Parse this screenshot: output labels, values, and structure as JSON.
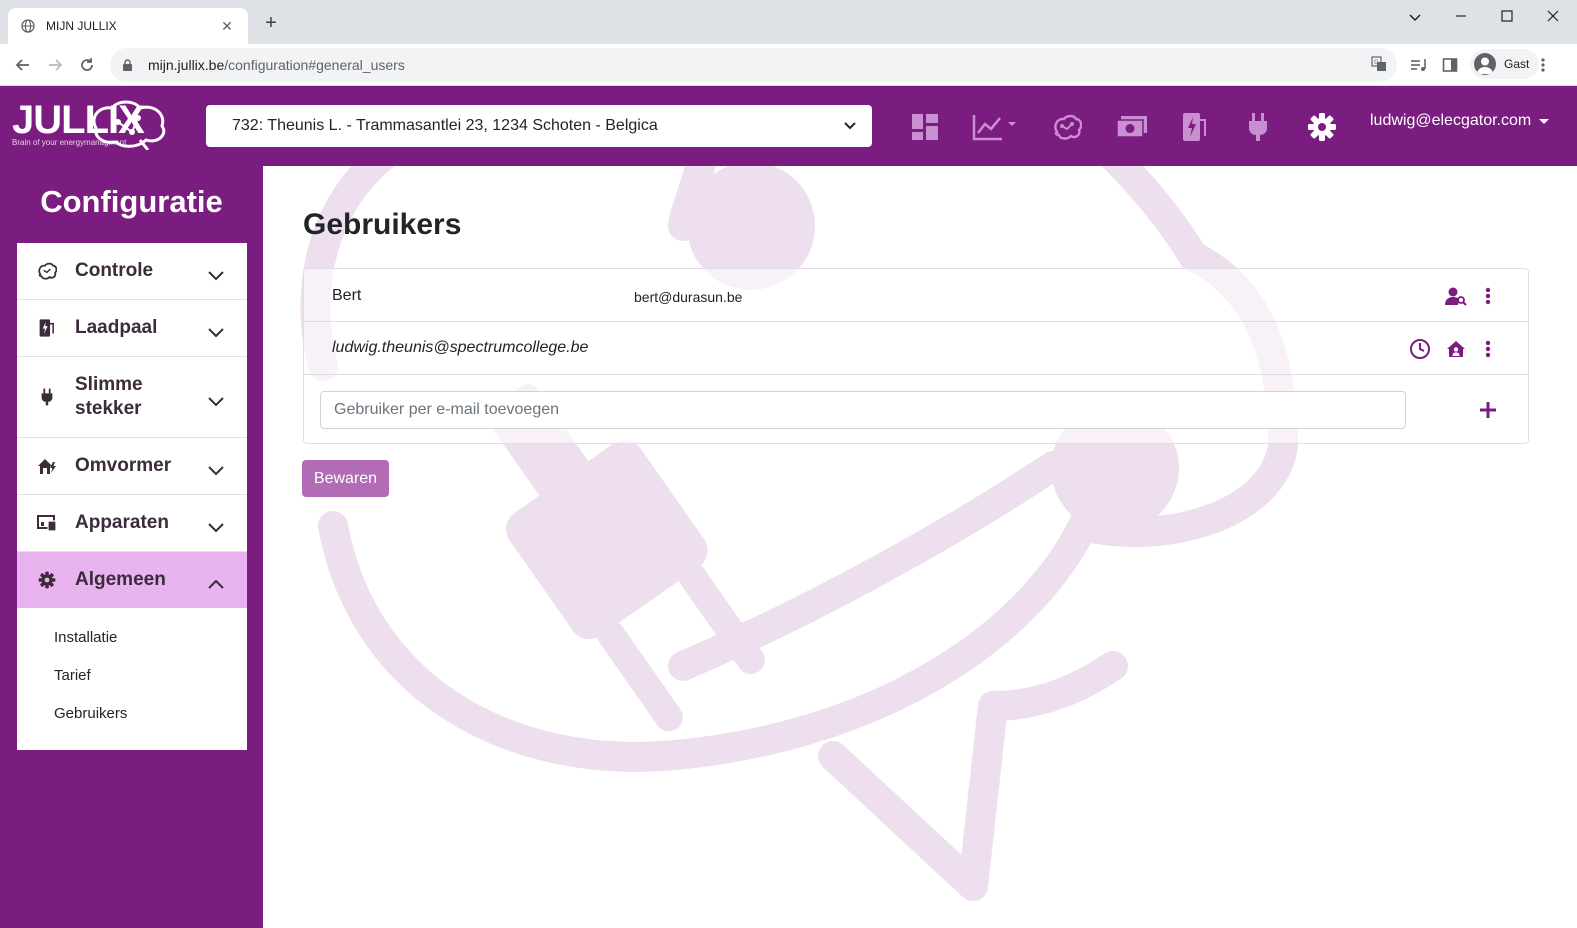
{
  "browser": {
    "tab_title": "MIJN JULLIX",
    "url_host": "mijn.jullix.be",
    "url_path": "/configuration#general_users",
    "profile_label": "Gast"
  },
  "header": {
    "logo_text": "JULLIX",
    "logo_tagline": "Brain of your energymanagment",
    "site_selected": "732: Theunis L. - Trammasantlei 23, 1234 Schoten - Belgica",
    "user_email": "ludwig@elecgator.com",
    "nav_icons": [
      "dashboard-icon",
      "chart-icon",
      "brain-icon",
      "money-icon",
      "charger-icon",
      "plug-icon",
      "gear-icon"
    ]
  },
  "sidebar": {
    "title": "Configuratie",
    "items": [
      {
        "label": "Controle",
        "icon": "brain-icon"
      },
      {
        "label": "Laadpaal",
        "icon": "charger-icon"
      },
      {
        "label": "Slimme stekker",
        "icon": "plug-icon"
      },
      {
        "label": "Omvormer",
        "icon": "solar-house-icon"
      },
      {
        "label": "Apparaten",
        "icon": "devices-icon"
      },
      {
        "label": "Algemeen",
        "icon": "gear-icon"
      }
    ],
    "sub_items": [
      "Installatie",
      "Tarief",
      "Gebruikers"
    ]
  },
  "main": {
    "title": "Gebruikers",
    "users": [
      {
        "name": "Bert",
        "email": "bert@durasun.be"
      },
      {
        "name": "",
        "email": "ludwig.theunis@spectrumcollege.be"
      }
    ],
    "add_placeholder": "Gebruiker per e-mail toevoegen",
    "save_label": "Bewaren"
  },
  "colors": {
    "brand": "#7b1d80",
    "active_item": "#e8b3ee",
    "save_button": "#b26bb5"
  }
}
